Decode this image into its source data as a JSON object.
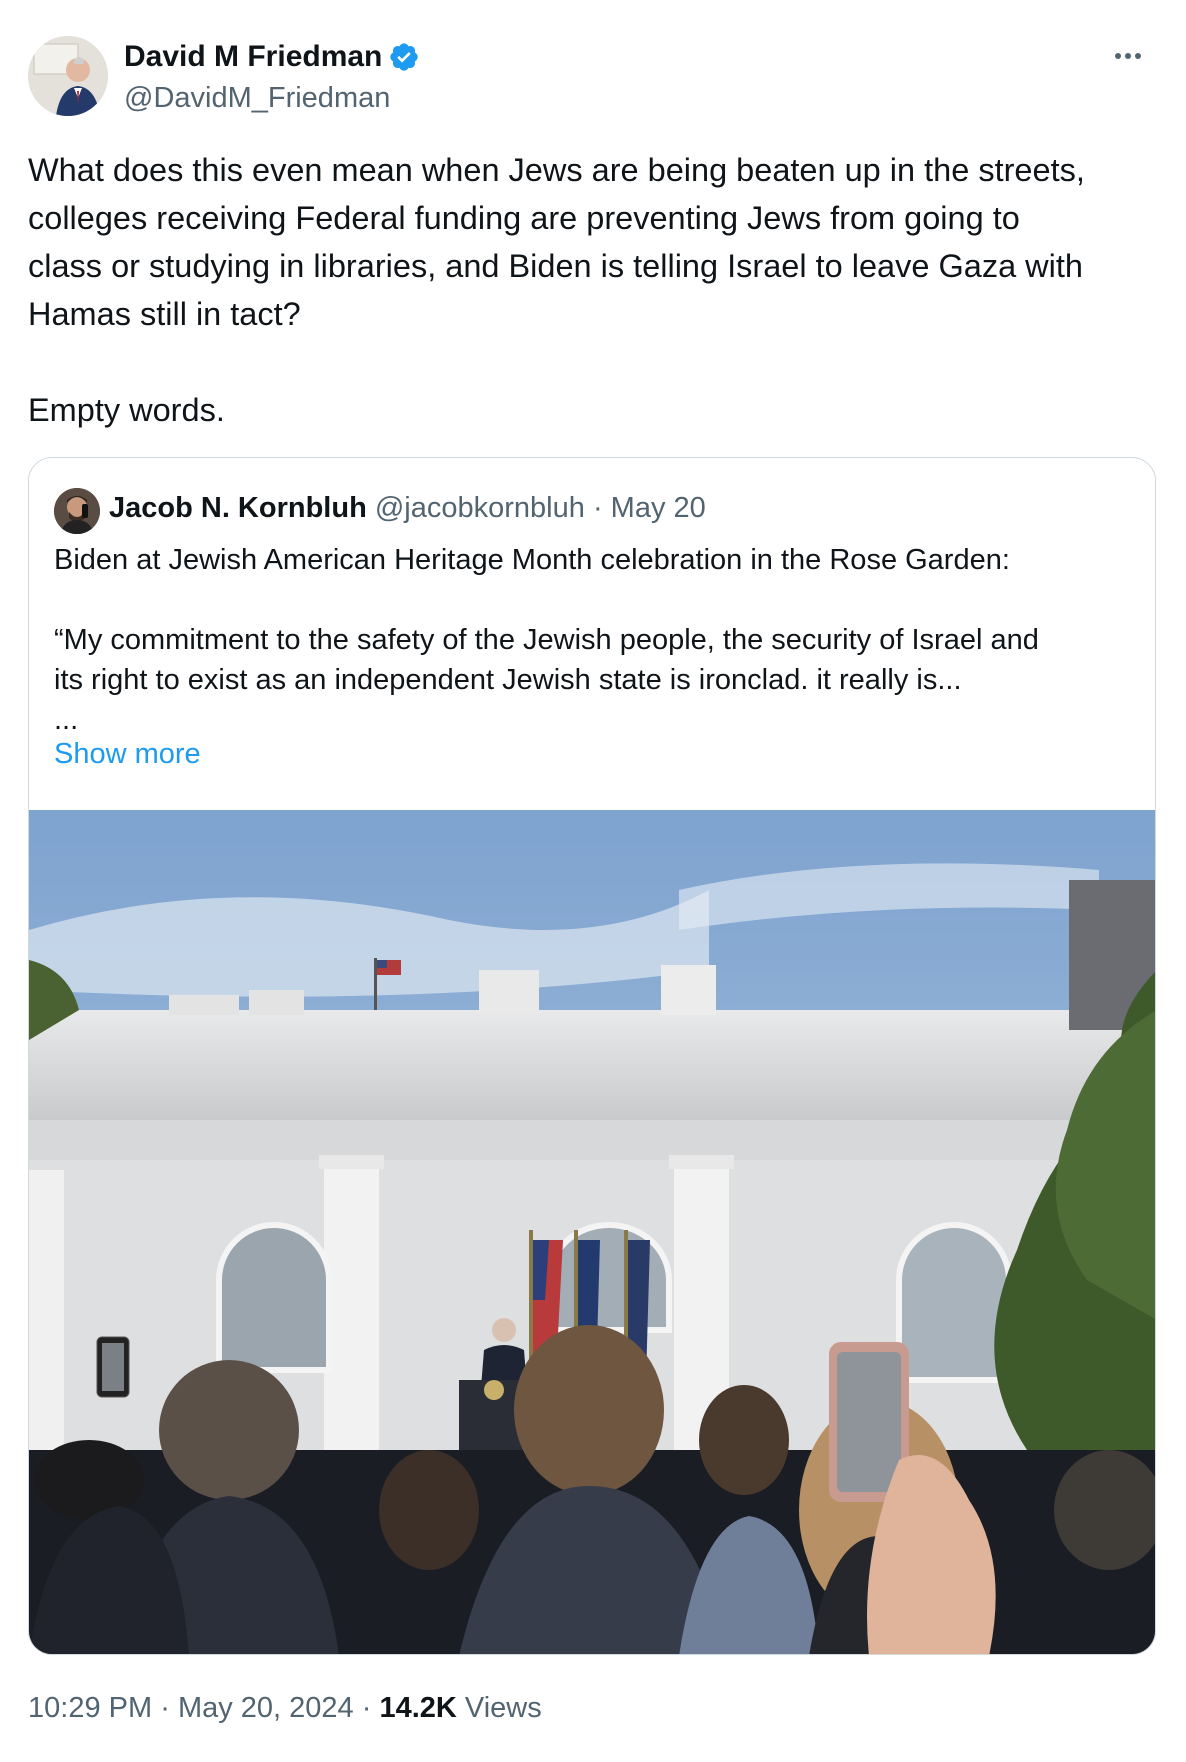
{
  "author": {
    "name": "David M Friedman",
    "handle": "@DavidM_Friedman",
    "verified_color": "#1d9bf0"
  },
  "more_icon": "more-horizontal-icon",
  "tweet": {
    "text_lines": [
      "What does this even mean when Jews are being beaten up in the streets,",
      "colleges receiving Federal funding are preventing Jews from going to",
      "class or studying in libraries, and Biden is telling Israel to leave Gaza with",
      "Hamas still in tact?"
    ],
    "closing": "Empty words."
  },
  "quote": {
    "name": "Jacob N. Kornbluh",
    "handle": "@jacobkornbluh",
    "separator": "·",
    "date": "May 20",
    "line1": "Biden at Jewish American Heritage Month celebration in the Rose Garden:",
    "line2": "“My commitment to the safety of the Jewish people, the security of Israel and",
    "line3": "its right to exist as an independent Jewish state is ironclad. it really is...",
    "line4": "...",
    "show_more": "Show more"
  },
  "footer": {
    "time": "10:29 PM",
    "sep1": "·",
    "date": "May 20, 2024",
    "sep2": "·",
    "views_count": "14.2K",
    "views_label": "Views"
  },
  "colors": {
    "text": "#0f1419",
    "secondary": "#536471",
    "link": "#1d9bf0",
    "border": "#cfd9de"
  }
}
